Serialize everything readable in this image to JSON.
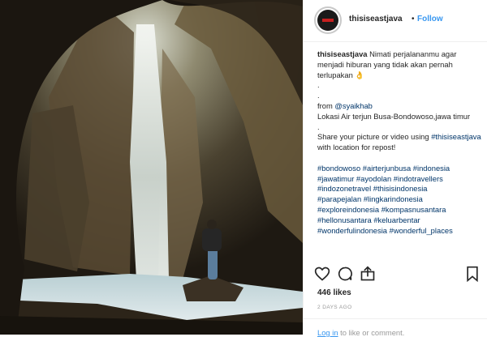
{
  "post": {
    "username": "thisiseastjava",
    "follow_label": "Follow",
    "dot": "•",
    "caption_intro": "Nimati perjalananmu agar menjadi hiburan yang tidak akan pernah terlupakan",
    "emoji": "👌",
    "separators": [
      ".",
      "."
    ],
    "from_label": "from",
    "credit": "@syaikhab",
    "location_line": "Lokasi Air terjun Busa-Bondowoso,jawa timur",
    "share_line": "Share your picture or video using",
    "share_tag": "#thisiseastjava",
    "share_tail": "with location for repost!",
    "hashtag_lines": [
      "#bondowoso #airterjunbusa #indonesia",
      "#jawatimur #ayodolan #indotravellers",
      "#indozonetravel #thisisindonesia",
      "#parapejalan #lingkarindonesia",
      "#exploreindonesia #kompasnusantara",
      "#hellonusantara #keluarbentar",
      "#wonderfulindonesia #wonderful_places"
    ],
    "likes": "446 likes",
    "date": "2 DAYS AGO",
    "login_link": "Log in",
    "login_tail": "to like or comment.",
    "icons": [
      "heart-icon",
      "comment-icon",
      "share-icon",
      "bookmark-icon"
    ]
  }
}
